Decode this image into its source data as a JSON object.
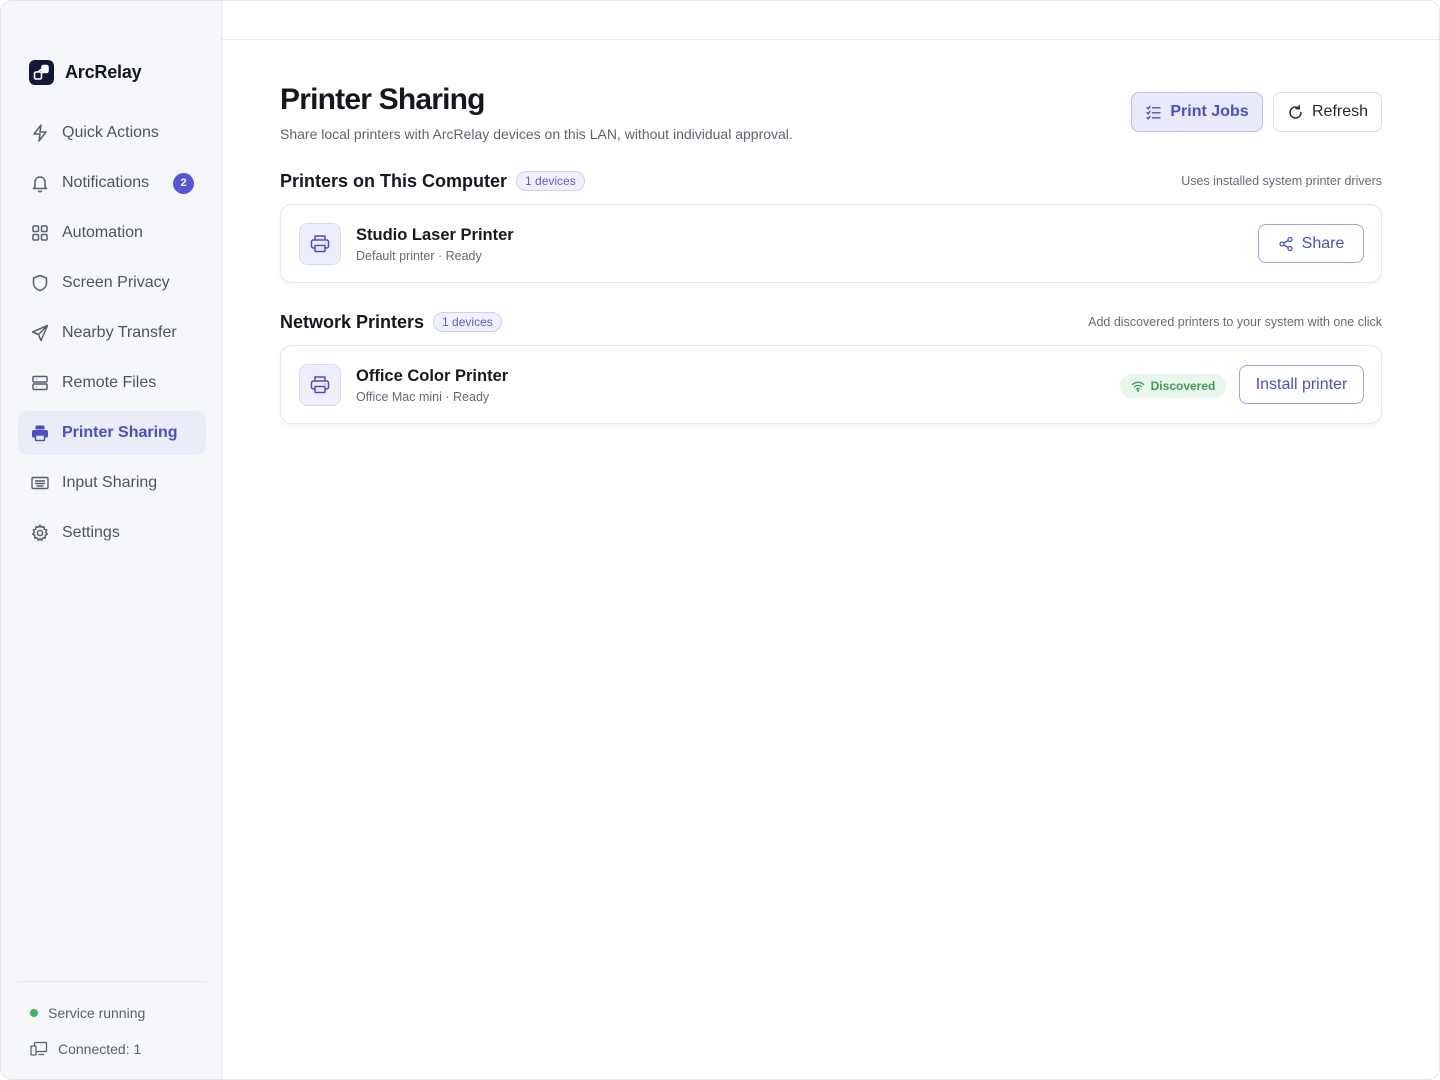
{
  "app": {
    "name": "ArcRelay"
  },
  "sidebar": {
    "items": [
      {
        "label": "Quick Actions",
        "icon": "bolt-icon"
      },
      {
        "label": "Notifications",
        "icon": "bell-icon",
        "badge": "2"
      },
      {
        "label": "Automation",
        "icon": "grid-icon"
      },
      {
        "label": "Screen Privacy",
        "icon": "shield-icon"
      },
      {
        "label": "Nearby Transfer",
        "icon": "send-icon"
      },
      {
        "label": "Remote Files",
        "icon": "server-icon"
      },
      {
        "label": "Printer Sharing",
        "icon": "printer-icon",
        "active": true
      },
      {
        "label": "Input Sharing",
        "icon": "keyboard-icon"
      },
      {
        "label": "Settings",
        "icon": "gear-icon"
      }
    ],
    "footer": {
      "service_status": "Service running",
      "connected": "Connected: 1"
    }
  },
  "page": {
    "title": "Printer Sharing",
    "subtitle": "Share local printers with ArcRelay devices on this LAN, without individual approval.",
    "actions": {
      "print_jobs": "Print Jobs",
      "refresh": "Refresh"
    }
  },
  "sections": {
    "local": {
      "title": "Printers on This Computer",
      "count": "1 devices",
      "note": "Uses installed system printer drivers",
      "printers": [
        {
          "name": "Studio Laser Printer",
          "detail": "Default printer · Ready",
          "action": "Share"
        }
      ]
    },
    "network": {
      "title": "Network Printers",
      "count": "1 devices",
      "note": "Add discovered printers to your system with one click",
      "printers": [
        {
          "name": "Office Color Printer",
          "detail": "Office Mac mini · Ready",
          "status": "Discovered",
          "action": "Install printer"
        }
      ]
    }
  },
  "colors": {
    "accent": "#5556d9",
    "active_text": "#4a4fc4",
    "success": "#3fb45d",
    "sidebar_bg": "#f6f7fb"
  }
}
